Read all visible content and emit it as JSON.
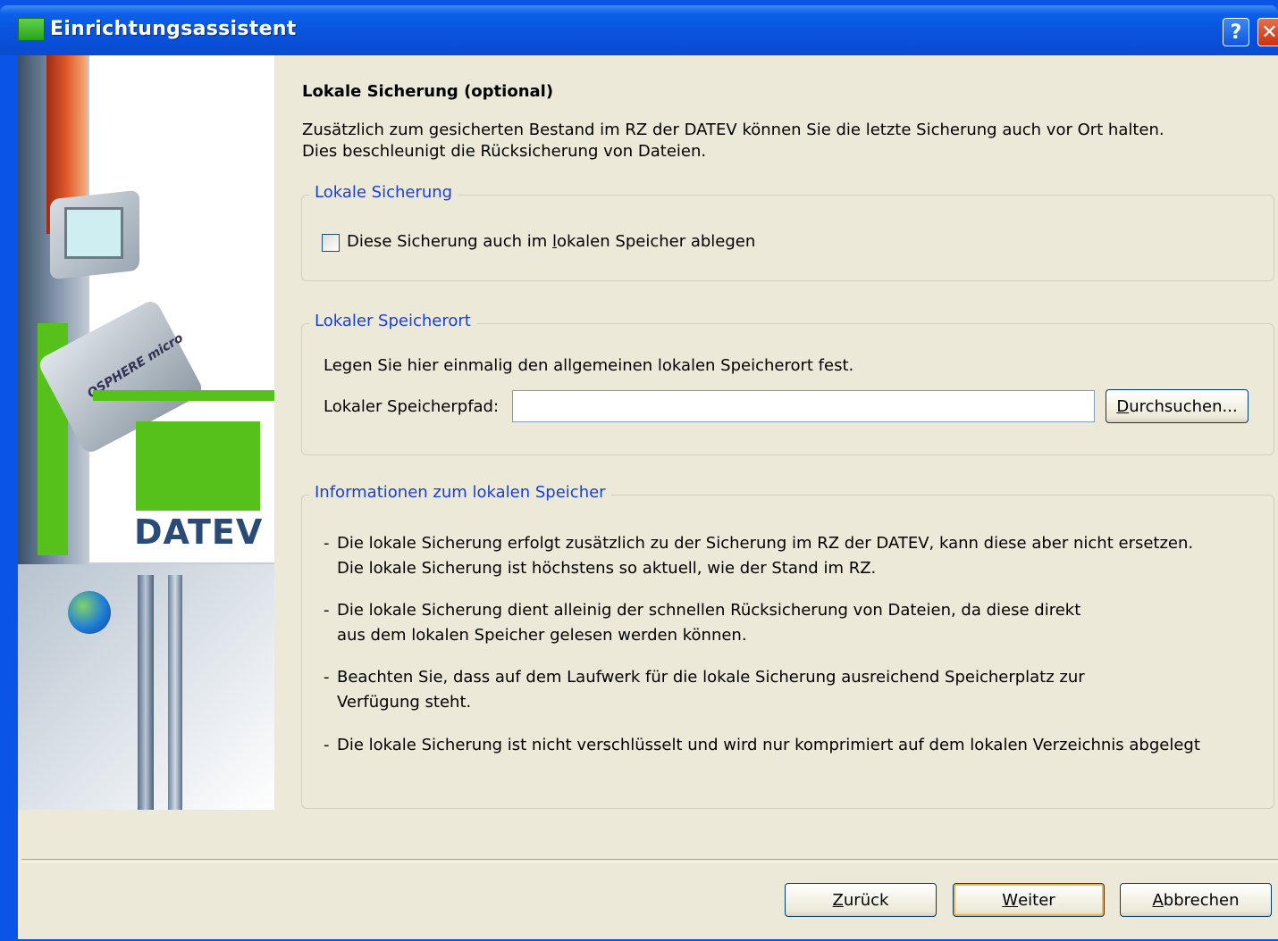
{
  "window": {
    "title": "Einrichtungsassistent",
    "help_label": "?",
    "close_label": "✕"
  },
  "side": {
    "logo_text": "DATEV",
    "device_label": "OSPHERE micro"
  },
  "page": {
    "heading": "Lokale Sicherung (optional)",
    "intro": "Zusätzlich zum gesicherten Bestand im RZ der DATEV können Sie die letzte Sicherung auch vor Ort halten.\nDies beschleunigt die Rücksicherung von Dateien."
  },
  "local_backup": {
    "legend": "Lokale Sicherung",
    "checkbox_label_pre": "Diese Sicherung auch im ",
    "checkbox_label_mnemonic": "l",
    "checkbox_label_post": "okalen Speicher ablegen",
    "checked": false
  },
  "storage_location": {
    "legend": "Lokaler Speicherort",
    "description": "Legen Sie hier einmalig den allgemeinen lokalen Speicherort fest.",
    "path_label": "Lokaler Speicherpfad:",
    "path_value": "",
    "browse_mnemonic": "D",
    "browse_rest": "urchsuchen..."
  },
  "info": {
    "legend": "Informationen zum lokalen Speicher",
    "items": [
      {
        "line1": "Die lokale Sicherung erfolgt zusätzlich zu der Sicherung im RZ der DATEV, kann diese aber nicht ersetzen.",
        "line2": "Die lokale Sicherung ist höchstens so aktuell, wie der Stand im RZ."
      },
      {
        "line1": "Die lokale Sicherung dient alleinig der schnellen Rücksicherung von Dateien, da diese direkt",
        "line2": "aus dem lokalen Speicher gelesen werden können."
      },
      {
        "line1": "Beachten Sie, dass auf dem Laufwerk für die lokale Sicherung ausreichend Speicherplatz zur",
        "line2": "Verfügung steht."
      },
      {
        "line1": "Die lokale Sicherung ist nicht verschlüsselt und wird nur komprimiert auf dem lokalen Verzeichnis abgelegt",
        "line2": ""
      }
    ],
    "dash": "-"
  },
  "nav": {
    "back_mnemonic": "Z",
    "back_rest": "urück",
    "next_mnemonic": "W",
    "next_rest": "eiter",
    "cancel_mnemonic": "A",
    "cancel_rest": "bbrechen"
  },
  "colors": {
    "titlebar": "#0a52dc",
    "legend_text": "#1a3fd8",
    "dialog_bg": "#ece9d8",
    "datev_green": "#56c11a"
  }
}
